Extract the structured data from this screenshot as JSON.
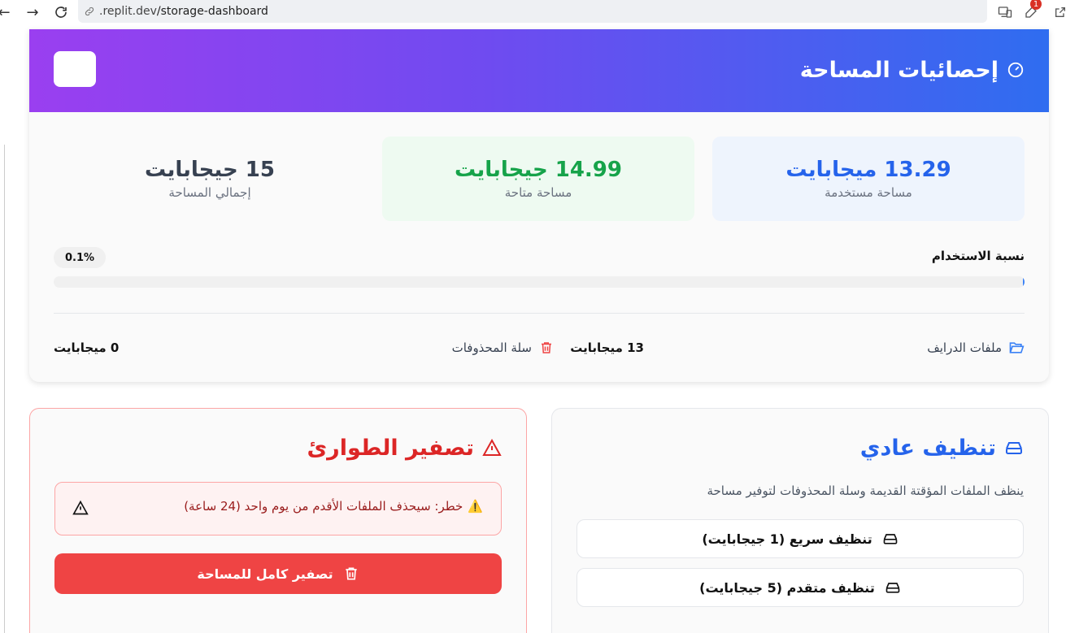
{
  "browser": {
    "url_prefix": ".replit.dev",
    "url_path": "/storage-dashboard",
    "extension_badge": "1"
  },
  "header": {
    "title": "إحصائيات المساحة"
  },
  "stats": {
    "used_value": "13.29 ميجابايت",
    "used_label": "مساحة مستخدمة",
    "free_value": "14.99 جيجابايت",
    "free_label": "مساحة متاحة",
    "total_value": "15 جيجابايت",
    "total_label": "إجمالي المساحة"
  },
  "usage": {
    "label": "نسبة الاستخدام",
    "percent_text": "0.1%",
    "percent_value": 0.1
  },
  "breakdown": {
    "drive_label": "ملفات الدرايف",
    "drive_value": "13 ميجابايت",
    "trash_label": "سلة المحذوفات",
    "trash_value": "0 ميجابايت"
  },
  "normal_clean": {
    "title": "تنظيف عادي",
    "description": "ينظف الملفات المؤقتة القديمة وسلة المحذوفات لتوفير مساحة",
    "quick_label": "تنظيف سريع (1 جيجابايت)",
    "advanced_label": "تنظيف متقدم (5 جيجابايت)"
  },
  "emergency": {
    "title": "تصفير الطوارئ",
    "warning_emoji": "⚠️",
    "warning_text": "خطر: سيحذف الملفات الأقدم من يوم واحد (24 ساعة)",
    "reset_label": "تصفير كامل للمساحة"
  },
  "colors": {
    "header_gradient_start": "#9a3ff0",
    "header_gradient_end": "#2f6df0",
    "used_accent": "#2563eb",
    "free_accent": "#16a34a",
    "danger": "#ef4444"
  },
  "icons": {
    "header": "gauge-icon",
    "drive": "folder-open-icon",
    "trash": "trash-icon",
    "normal_title": "hard-drive-icon",
    "emergency_title": "warning-triangle-icon"
  }
}
